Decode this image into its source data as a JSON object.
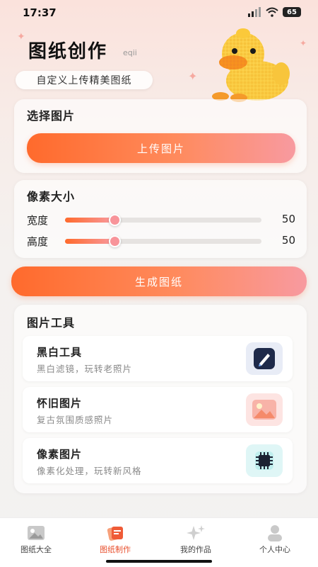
{
  "status_bar": {
    "time": "17:37",
    "battery": "65"
  },
  "header": {
    "title": "图纸创作",
    "brand_mark": "eqii",
    "pill_label": "自定义上传精美图纸"
  },
  "select_image": {
    "title": "选择图片",
    "upload_label": "上传图片"
  },
  "pixel_size": {
    "title": "像素大小",
    "width": {
      "label": "宽度",
      "value": "50",
      "fraction": 0.25
    },
    "height": {
      "label": "高度",
      "value": "50",
      "fraction": 0.25
    }
  },
  "generate_label": "生成图纸",
  "tools": {
    "title": "图片工具",
    "items": [
      {
        "name": "黑白工具",
        "desc": "黑白滤镜，玩转老照片",
        "icon": "pen-edit-icon"
      },
      {
        "name": "怀旧图片",
        "desc": "复古氛围质感照片",
        "icon": "landscape-photo-icon"
      },
      {
        "name": "像素图片",
        "desc": "像素化处理，玩转新风格",
        "icon": "chip-icon"
      }
    ]
  },
  "nav": {
    "items": [
      {
        "label": "图纸大全",
        "icon": "gallery-icon"
      },
      {
        "label": "图纸制作",
        "icon": "cards-icon",
        "active": true
      },
      {
        "label": "我的作品",
        "icon": "sparkle-icon"
      },
      {
        "label": "个人中心",
        "icon": "user-icon"
      }
    ]
  },
  "colors": {
    "accent": "#ff6a2c",
    "accent_pink": "#f89aa0",
    "active_nav": "#e8502e"
  }
}
